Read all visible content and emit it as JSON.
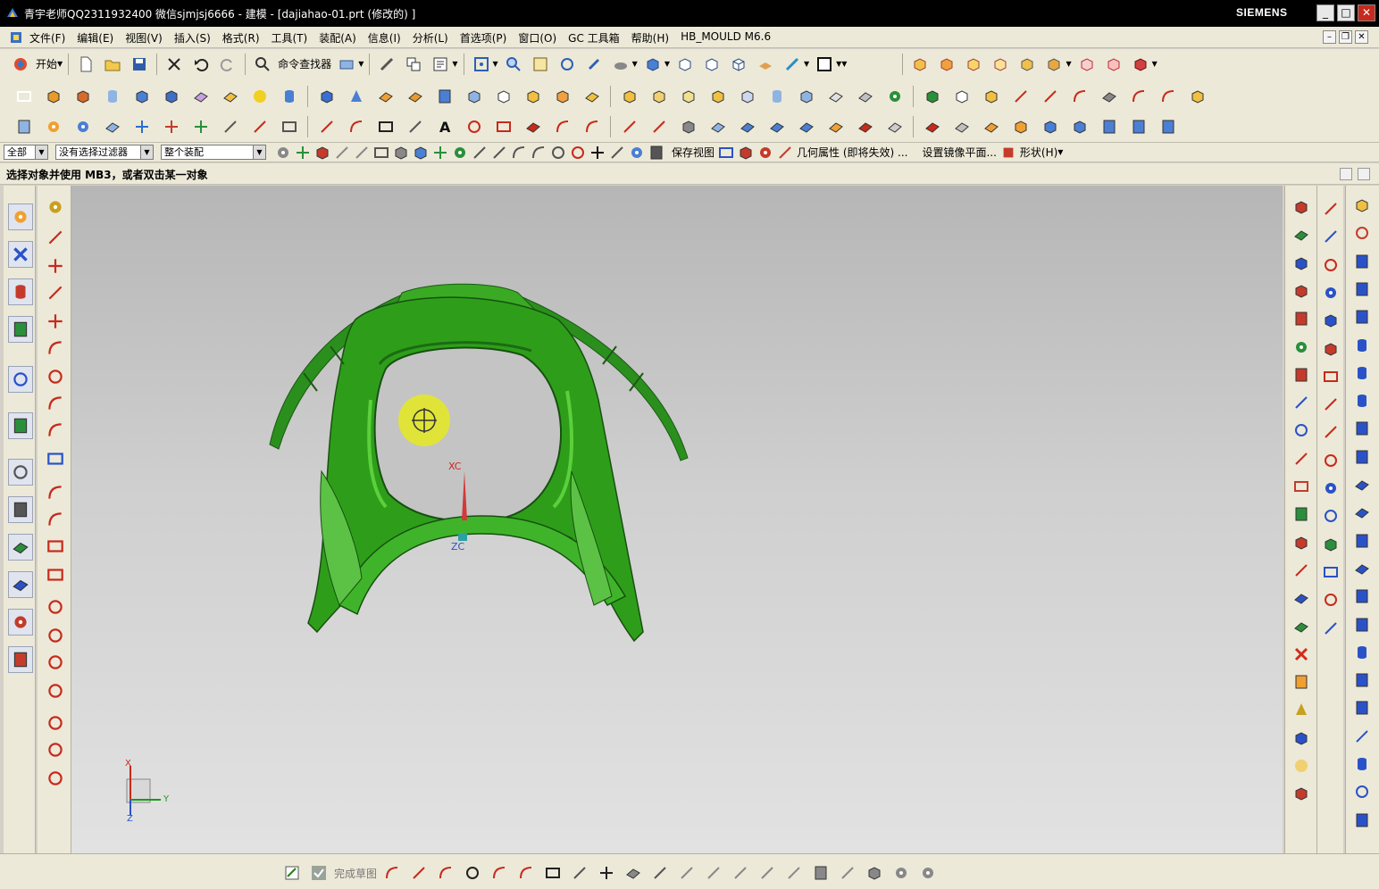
{
  "window": {
    "title": "青宇老师QQ2311932400 微信sjmjsj6666 - 建模 - [dajiahao-01.prt  (修改的) ]",
    "brand": "SIEMENS",
    "minimize": "_",
    "maximize": "□",
    "close": "✕"
  },
  "menubar": {
    "items": [
      "文件(F)",
      "编辑(E)",
      "视图(V)",
      "插入(S)",
      "格式(R)",
      "工具(T)",
      "装配(A)",
      "信息(I)",
      "分析(L)",
      "首选项(P)",
      "窗口(O)",
      "GC 工具箱",
      "帮助(H)",
      "HB_MOULD M6.6"
    ]
  },
  "toolbar1": {
    "start_label": "开始",
    "command_finder_label": "命令查找器"
  },
  "selection_bar": {
    "type_filter": "全部",
    "selection_filter": "没有选择过滤器",
    "scope": "整个装配",
    "save_view": "保存视图",
    "geometry_property": "几何属性 (即将失效) ...",
    "set_mirror_plane": "设置镜像平面...",
    "shape": "形状(H)"
  },
  "cue_line": {
    "text": "选择对象并使用 MB3，或者双击某一对象"
  },
  "viewport": {
    "wcs_label_x": "XC",
    "wcs_label_z": "ZC",
    "triad_x": "X",
    "triad_y": "Y",
    "triad_z": "Z",
    "model_color": "#2e9e1a",
    "highlight_color": "#e3e82a"
  },
  "bottom_bar": {
    "finish_sketch": "完成草图"
  },
  "colors": {
    "toolbar_bg": "#ece9d8",
    "titlebar_bg": "#000000",
    "close_red": "#c62a1c"
  }
}
